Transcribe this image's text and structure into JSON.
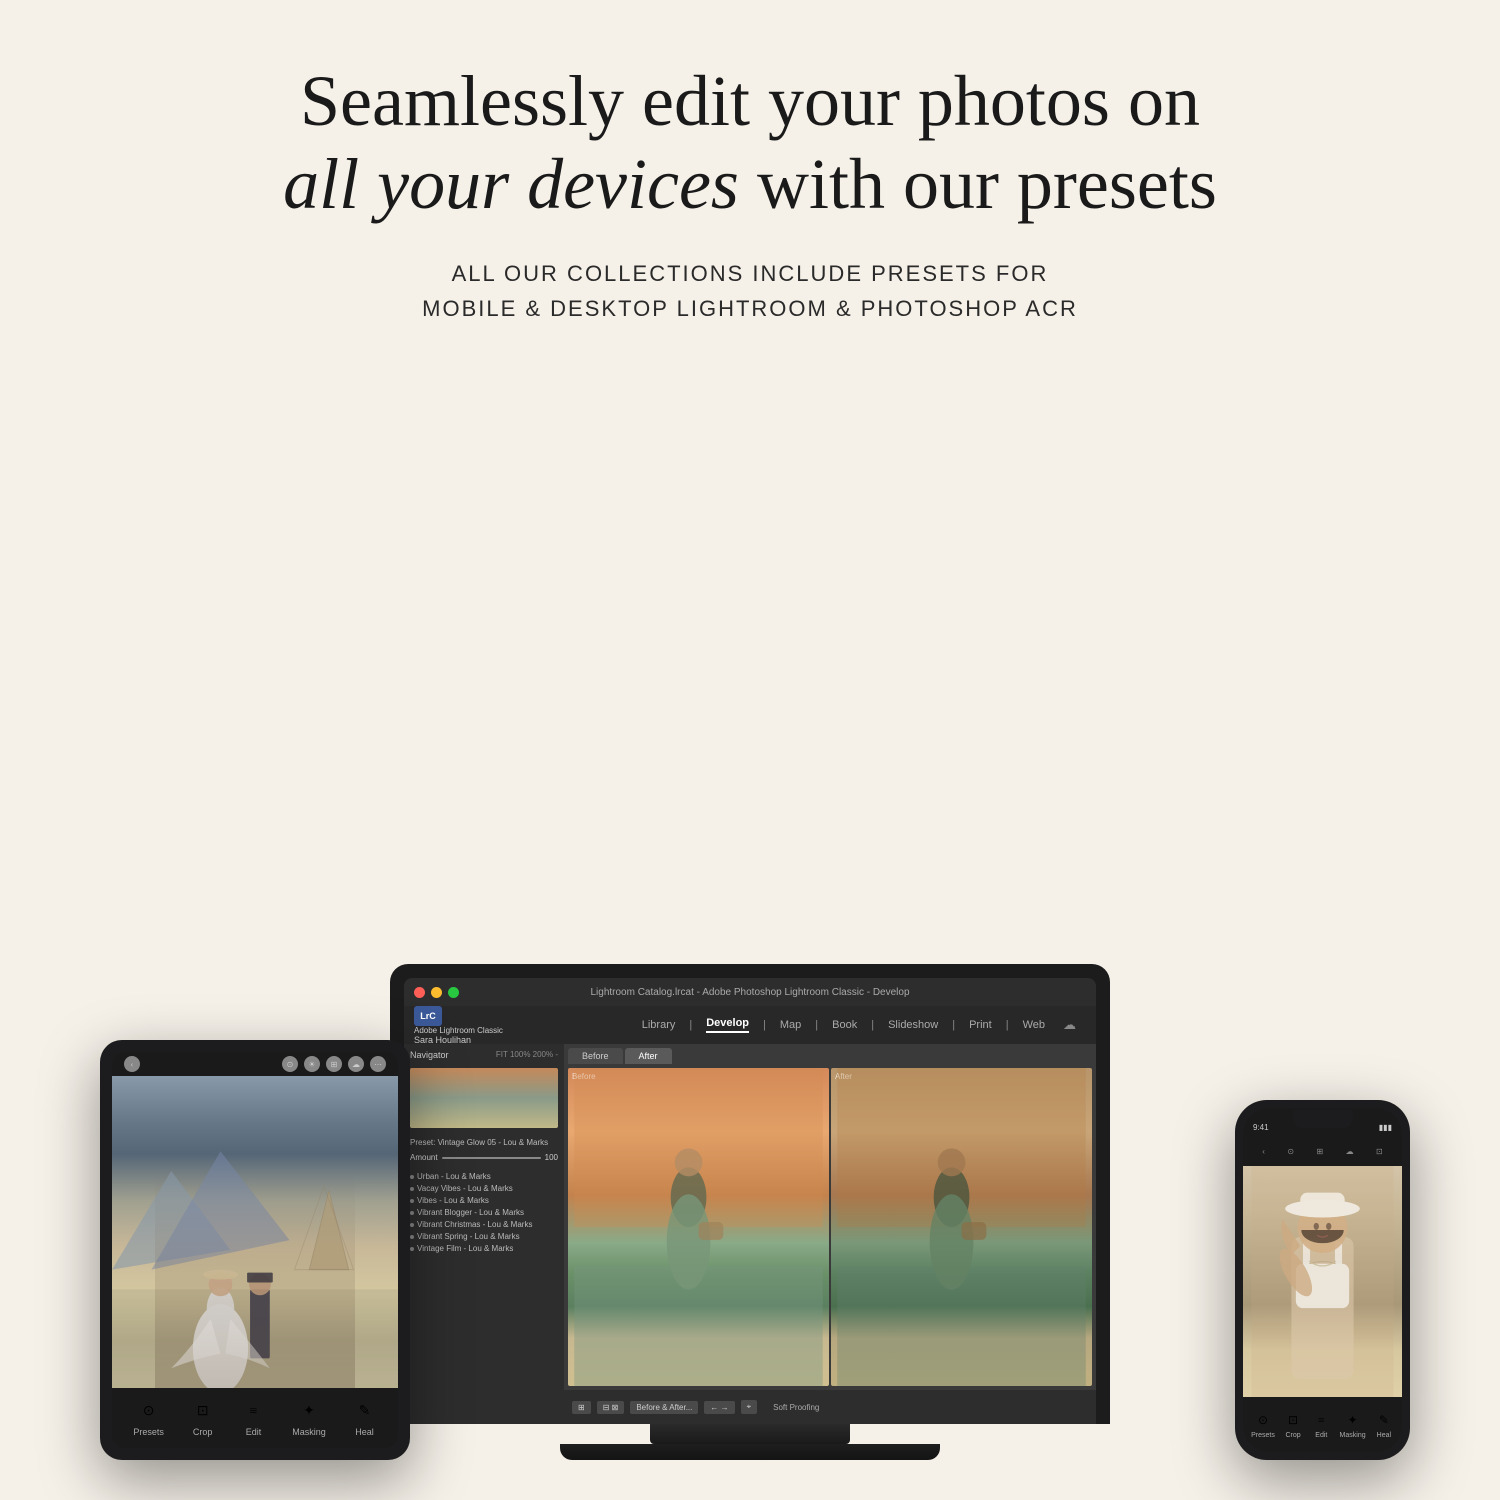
{
  "page": {
    "background_color": "#f5f0e8"
  },
  "headline": {
    "line1": "Seamlessly edit your photos on",
    "line2_italic": "all your devices",
    "line2_normal": " with our presets"
  },
  "subtitle": {
    "line1": "ALL OUR COLLECTIONS INCLUDE PRESETS FOR",
    "line2": "MOBILE & DESKTOP LIGHTROOM & PHOTOSHOP ACR"
  },
  "laptop": {
    "title_bar": "Lightroom Catalog.lrcat - Adobe Photoshop Lightroom Classic - Develop",
    "user_name": "Sara Houlihan",
    "app_name": "Adobe Lightroom Classic",
    "logo_text": "LrC",
    "nav_tabs": [
      "Library",
      "Develop",
      "Map",
      "Book",
      "Slideshow",
      "Print",
      "Web"
    ],
    "active_tab": "Develop",
    "before_after_tabs": [
      "Before",
      "After"
    ],
    "preset_label": "Preset: Vintage Glow 05 - Lou & Marks",
    "amount_label": "Amount",
    "amount_value": "100",
    "presets": [
      "Urban - Lou & Marks",
      "Vacay Vibes - Lou & Marks",
      "Vibes - Lou & Marks",
      "Vibrant Blogger - Lou & Marks",
      "Vibrant Christmas - Lou & Marks",
      "Vibrant Spring - Lou & Marks",
      "Vintage Film - Lou & Marks"
    ],
    "bottom_btn": "Before & After...",
    "soft_proof": "Soft Proofing",
    "navigator_label": "Navigator"
  },
  "tablet": {
    "toolbar_tools": [
      {
        "icon": "⊙",
        "label": "Presets"
      },
      {
        "icon": "⊡",
        "label": "Crop"
      },
      {
        "icon": "≡",
        "label": "Edit"
      },
      {
        "icon": "✦",
        "label": "Masking"
      },
      {
        "icon": "✎",
        "label": "Heal"
      }
    ]
  },
  "phone": {
    "toolbar_tools": [
      {
        "icon": "⊙",
        "label": "Presets"
      },
      {
        "icon": "⊡",
        "label": "Crop"
      },
      {
        "icon": "≡",
        "label": "Edit"
      },
      {
        "icon": "✦",
        "label": "Masking"
      },
      {
        "icon": "✎",
        "label": "Heal"
      }
    ],
    "status_left": "9:41",
    "status_right": "▮▮▮"
  }
}
